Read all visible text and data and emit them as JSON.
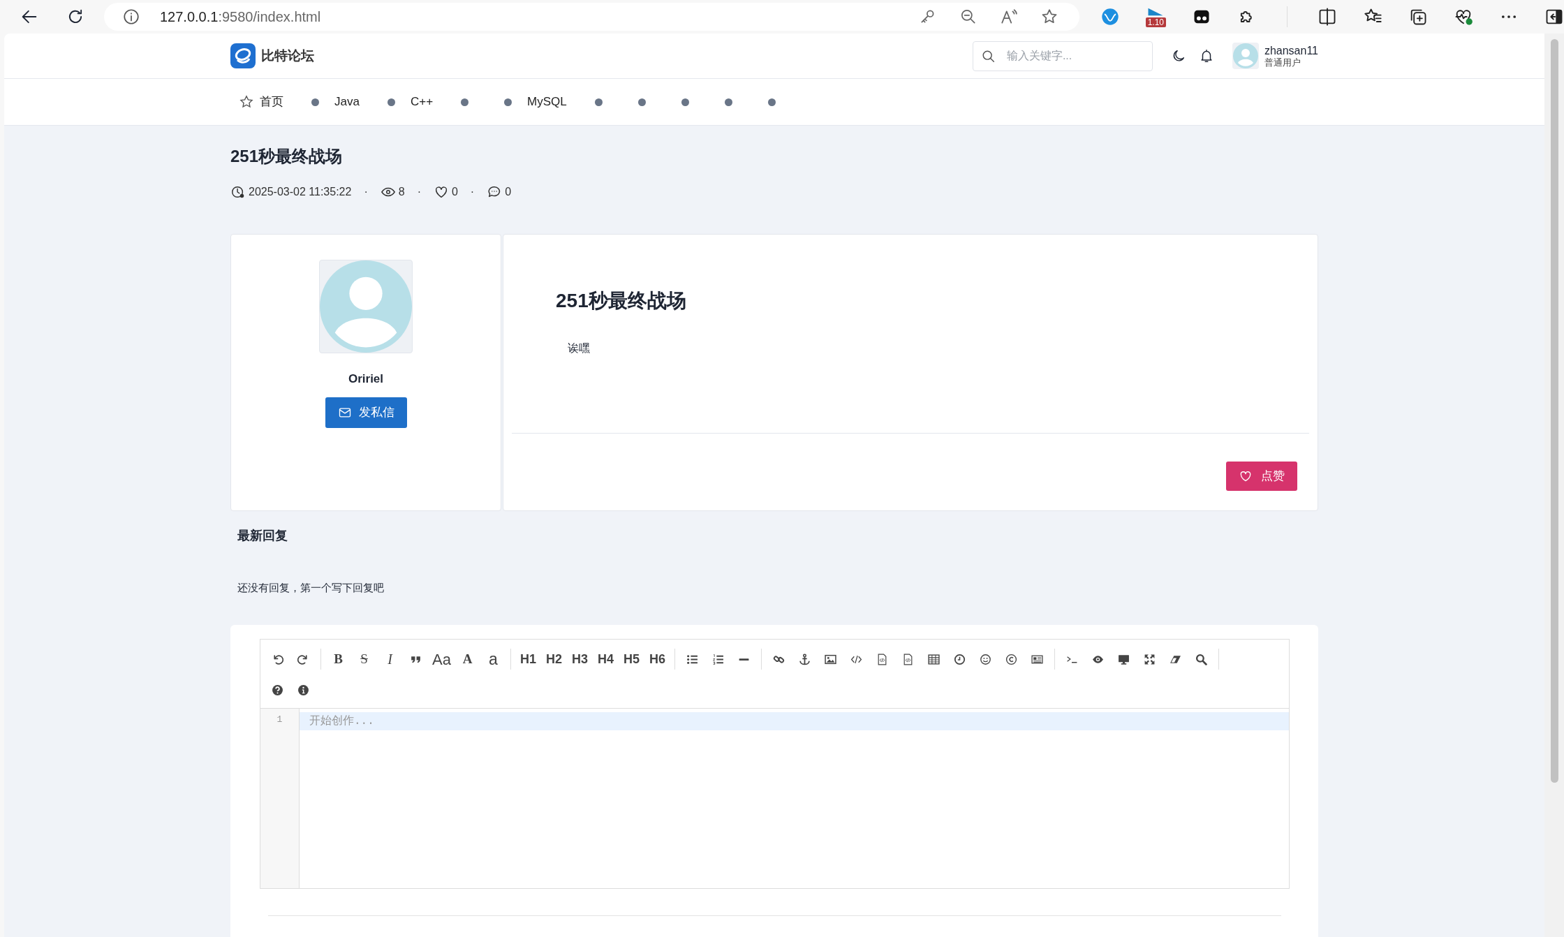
{
  "browser": {
    "address": {
      "host": "127.0.0.1",
      "path": ":9580/index.html"
    },
    "extension_badge": "1.10"
  },
  "header": {
    "brand": "比特论坛",
    "search": {
      "placeholder": "输入关键字..."
    },
    "user": {
      "name": "zhansan11",
      "role": "普通用户"
    }
  },
  "nav": [
    {
      "kind": "home",
      "label": "首页"
    },
    {
      "kind": "board",
      "label": "Java"
    },
    {
      "kind": "board",
      "label": "C++"
    },
    {
      "kind": "board"
    },
    {
      "kind": "board",
      "label": "MySQL"
    },
    {
      "kind": "board"
    },
    {
      "kind": "board"
    },
    {
      "kind": "board"
    },
    {
      "kind": "board"
    },
    {
      "kind": "board"
    }
  ],
  "post": {
    "title": "251秒最终战场",
    "meta": [
      {
        "kind": "time",
        "value": "2025-03-02 11:35:22"
      },
      {
        "kind": "views",
        "value": "8"
      },
      {
        "kind": "likes",
        "value": "0"
      },
      {
        "kind": "replies",
        "value": "0"
      }
    ],
    "separators": [
      "·",
      "·",
      "·"
    ]
  },
  "author": {
    "name": "Oririel",
    "message_button": "发私信"
  },
  "article": {
    "title": "251秒最终战场",
    "body": "诶嘿",
    "like_button": "点赞"
  },
  "replies": {
    "heading": "最新回复",
    "empty_text": "还没有回复，第一个写下回复吧"
  },
  "editor": {
    "toolbar_labels": [
      "B",
      "S",
      "I",
      "Aa",
      "A",
      "a",
      "H1",
      "H2",
      "H3",
      "H4",
      "H5",
      "H6"
    ],
    "line_numbers": [
      "1"
    ],
    "placeholder": "开始创作..."
  }
}
